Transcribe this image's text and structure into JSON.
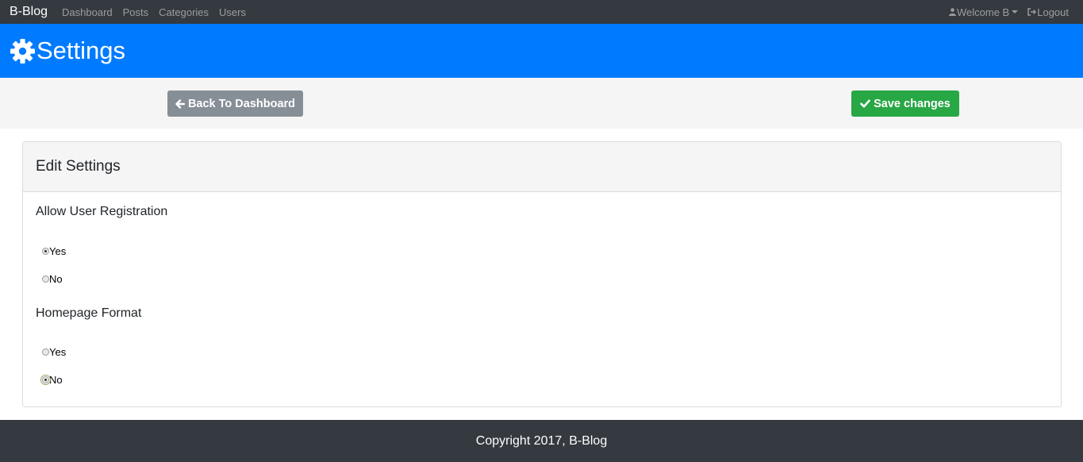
{
  "navbar": {
    "brand": "B-Blog",
    "links": [
      "Dashboard",
      "Posts",
      "Categories",
      "Users"
    ],
    "welcome": "Welcome B",
    "logout": "Logout"
  },
  "header": {
    "title": "Settings",
    "icon": "gear-icon"
  },
  "actions": {
    "back_label": "Back To Dashboard",
    "save_label": "Save changes",
    "back_color": "#868e96",
    "save_color": "#28a745"
  },
  "card": {
    "title": "Edit Settings",
    "groups": [
      {
        "label": "Allow User Registration",
        "options": [
          {
            "label": "Yes",
            "checked": true
          },
          {
            "label": "No",
            "checked": false
          }
        ]
      },
      {
        "label": "Homepage Format",
        "options": [
          {
            "label": "Yes",
            "checked": false
          },
          {
            "label": "No",
            "checked": true
          }
        ]
      }
    ]
  },
  "footer": {
    "text": "Copyright 2017, B-Blog"
  },
  "colors": {
    "navbar": "#343a40",
    "header": "#007bff",
    "footer": "#343a40"
  }
}
